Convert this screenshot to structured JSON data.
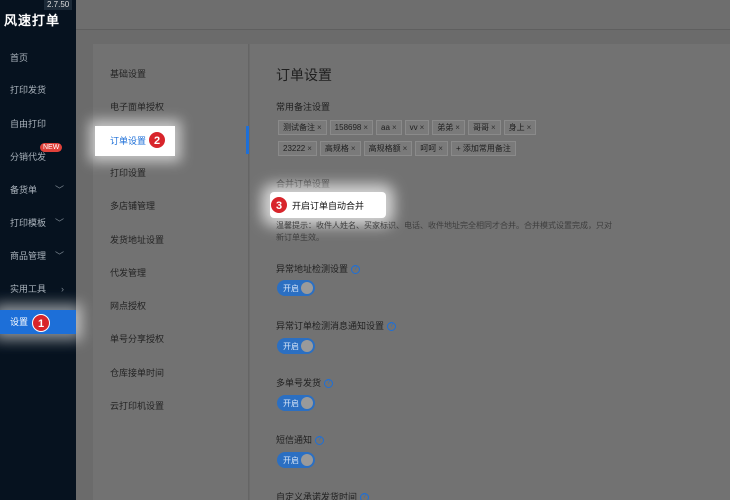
{
  "app": {
    "title": "风速打单",
    "version": "2.7.50"
  },
  "nav": {
    "items": [
      {
        "label": "首页",
        "arrow": ""
      },
      {
        "label": "打印发货",
        "arrow": ""
      },
      {
        "label": "自由打印",
        "arrow": ""
      },
      {
        "label": "分销代发",
        "arrow": "",
        "badge": "NEW"
      },
      {
        "label": "备货单",
        "arrow": "﹀"
      },
      {
        "label": "打印模板",
        "arrow": "﹀"
      },
      {
        "label": "商品管理",
        "arrow": "﹀"
      },
      {
        "label": "实用工具",
        "arrow": "›"
      },
      {
        "label": "设置",
        "arrow": ""
      }
    ]
  },
  "subnav": {
    "items": [
      "基础设置",
      "电子面单授权",
      "订单设置",
      "打印设置",
      "多店铺管理",
      "发货地址设置",
      "代发管理",
      "网点授权",
      "单号分享授权",
      "仓库接单时间",
      "云打印机设置"
    ]
  },
  "main": {
    "title": "订单设置",
    "remarks_title": "常用备注设置",
    "tags": [
      "测试备注",
      "158698",
      "aa",
      "vv",
      "弟弟",
      "哥哥",
      "身上",
      "23222",
      "高规格",
      "高规格额",
      "呵呵"
    ],
    "add_tag": "+ 添加常用备注",
    "merge_title": "合并订单设置",
    "merge_label": "开启订单自动合并",
    "merge_hint": "温馨提示：收件人姓名、买家标识、电话、收件地址完全相同才合并。合并模式设置完成，只对新订单生效。",
    "sections": [
      {
        "label": "异常地址检测设置",
        "toggle": "开启"
      },
      {
        "label": "异常订单检测消息通知设置",
        "toggle": "开启"
      },
      {
        "label": "多单号发货",
        "toggle": "开启"
      },
      {
        "label": "短信通知",
        "toggle": "开启"
      },
      {
        "label": "自定义承诺发货时间",
        "toggle": ""
      }
    ],
    "help_glyph": "?"
  },
  "steps": [
    "1",
    "2",
    "3"
  ]
}
